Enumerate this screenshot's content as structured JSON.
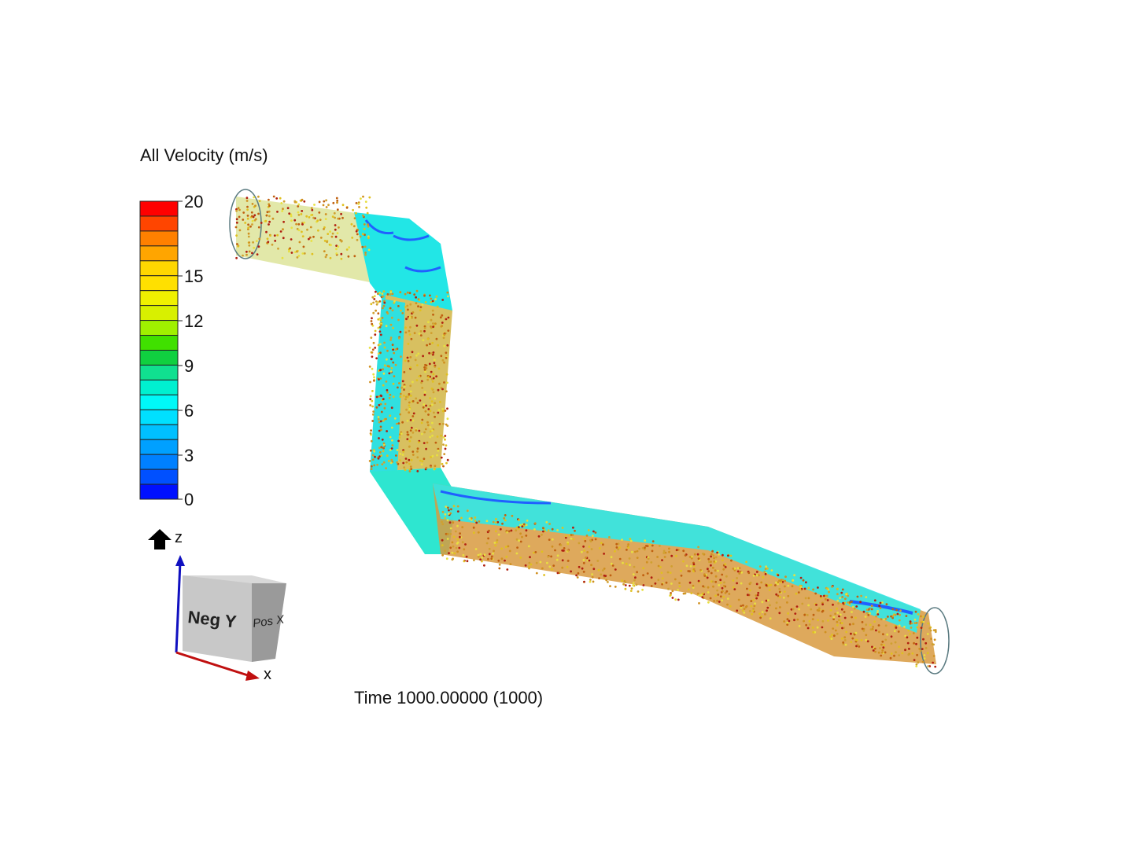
{
  "legend": {
    "title": "All Velocity (m/s)",
    "ticks": [
      "20",
      "15",
      "12",
      "9",
      "6",
      "3",
      "0"
    ],
    "colors": [
      "#ff0000",
      "#ff4500",
      "#ff8000",
      "#ffa500",
      "#ffd700",
      "#ffe000",
      "#f0f000",
      "#d8f000",
      "#a0f000",
      "#40e000",
      "#10d040",
      "#10e090",
      "#00f0d0",
      "#00f8f8",
      "#00e0ff",
      "#00c0ff",
      "#00a0ff",
      "#0080ff",
      "#0050ff",
      "#0010ff"
    ]
  },
  "orientation": {
    "z_label": "z",
    "x_label": "x",
    "cube_front": "Neg Y",
    "cube_side": "Pos X",
    "home_icon": "home-arrow-icon"
  },
  "status": {
    "time_text": "Time 1000.00000 (1000)"
  }
}
